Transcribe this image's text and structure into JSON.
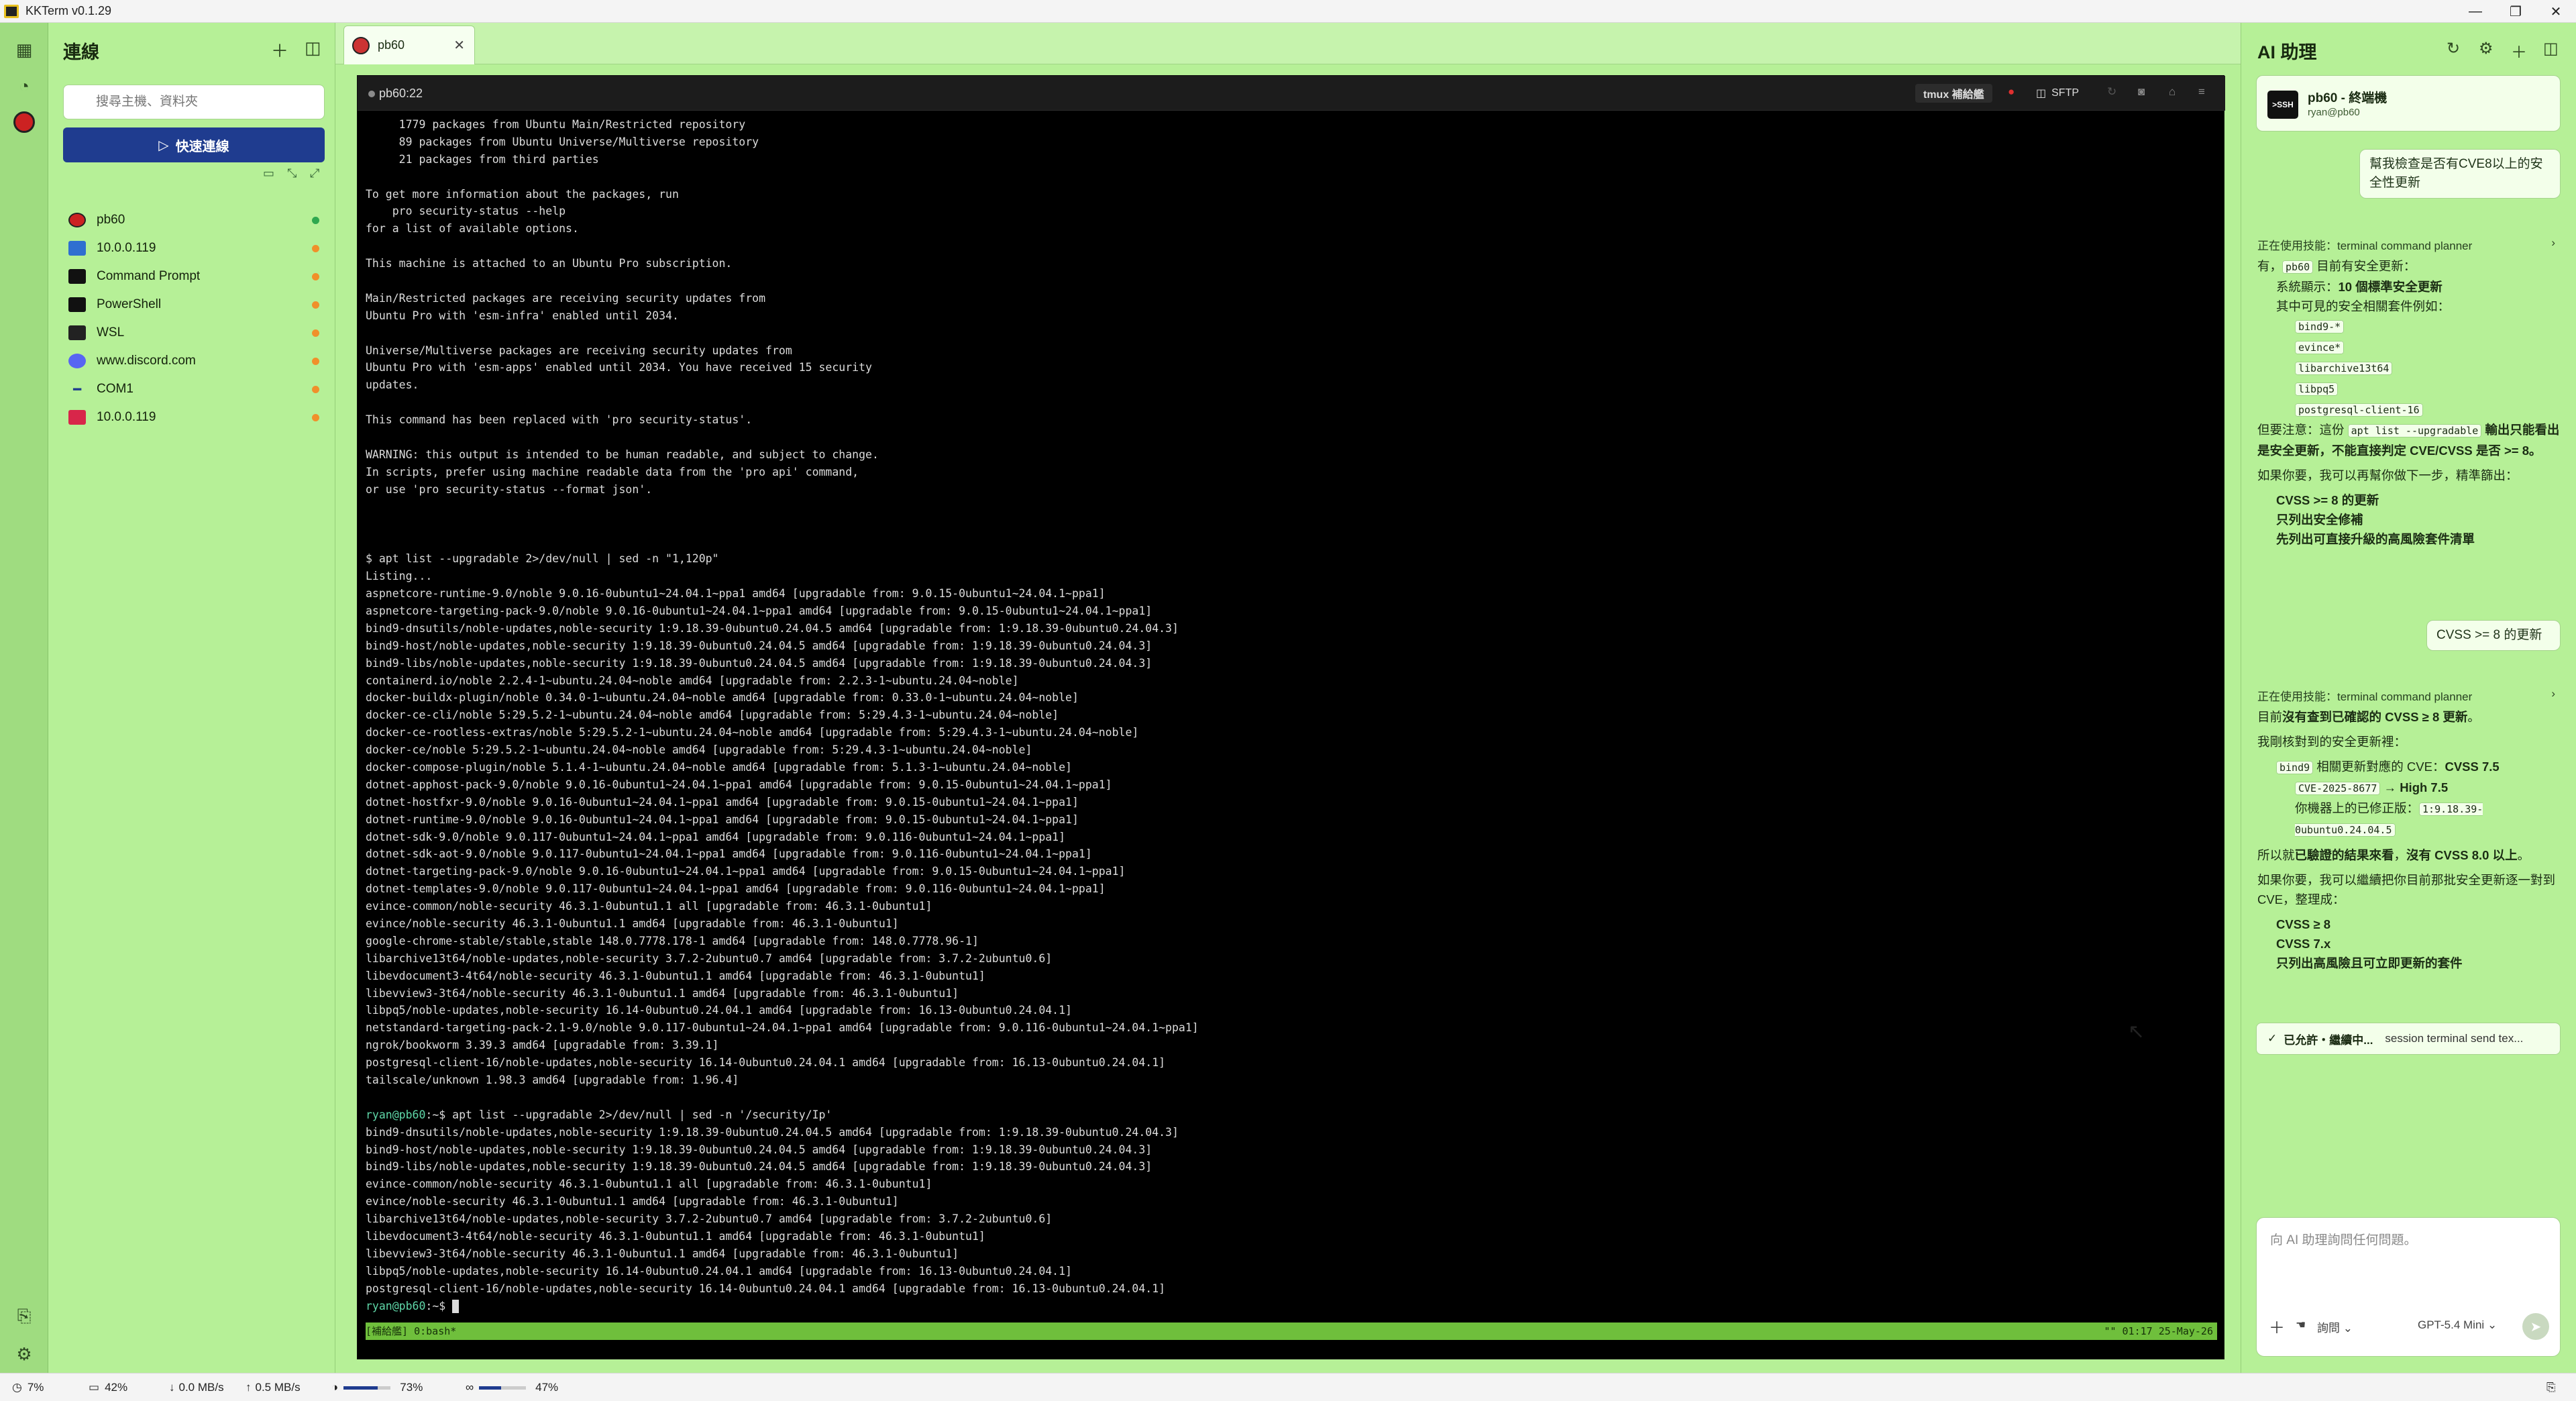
{
  "app": {
    "title": "KKTerm v0.1.29"
  },
  "sidebar": {
    "title": "連線",
    "search_placeholder": "搜尋主機、資料夾",
    "quick_connect": "快速連線",
    "connections": [
      {
        "label": "pb60",
        "icon": "ssh-icon",
        "status_color": "#2fa84f"
      },
      {
        "label": "10.0.0.119",
        "icon": "rdp-icon",
        "status_color": "#f0902a"
      },
      {
        "label": "Command Prompt",
        "icon": "cmd-icon",
        "status_color": "#f0902a"
      },
      {
        "label": "PowerShell",
        "icon": "powershell-icon",
        "status_color": "#f0902a"
      },
      {
        "label": "WSL",
        "icon": "wsl-icon",
        "status_color": "#f0902a"
      },
      {
        "label": "www.discord.com",
        "icon": "web-icon",
        "status_color": "#f0902a"
      },
      {
        "label": "COM1",
        "icon": "serial-icon",
        "status_color": "#f0902a"
      },
      {
        "label": "10.0.0.119",
        "icon": "vnc-icon",
        "status_color": "#f0902a"
      }
    ]
  },
  "tabs": [
    {
      "label": "pb60"
    }
  ],
  "terminal": {
    "session_name": "pb60:22",
    "tmux_button": "tmux 補給艦",
    "sftp_button": "SFTP",
    "lines": [
      "     1779 packages from Ubuntu Main/Restricted repository",
      "     89 packages from Ubuntu Universe/Multiverse repository",
      "     21 packages from third parties",
      "",
      "To get more information about the packages, run",
      "    pro security-status --help",
      "for a list of available options.",
      "",
      "This machine is attached to an Ubuntu Pro subscription.",
      "",
      "Main/Restricted packages are receiving security updates from",
      "Ubuntu Pro with 'esm-infra' enabled until 2034.",
      "",
      "Universe/Multiverse packages are receiving security updates from",
      "Ubuntu Pro with 'esm-apps' enabled until 2034. You have received 15 security",
      "updates.",
      "",
      "This command has been replaced with 'pro security-status'.",
      "",
      "WARNING: this output is intended to be human readable, and subject to change.",
      "In scripts, prefer using machine readable data from the 'pro api' command,",
      "or use 'pro security-status --format json'.",
      "",
      "",
      "",
      "$ apt list --upgradable 2>/dev/null | sed -n \"1,120p\"",
      "Listing...",
      "aspnetcore-runtime-9.0/noble 9.0.16-0ubuntu1~24.04.1~ppa1 amd64 [upgradable from: 9.0.15-0ubuntu1~24.04.1~ppa1]",
      "aspnetcore-targeting-pack-9.0/noble 9.0.16-0ubuntu1~24.04.1~ppa1 amd64 [upgradable from: 9.0.15-0ubuntu1~24.04.1~ppa1]",
      "bind9-dnsutils/noble-updates,noble-security 1:9.18.39-0ubuntu0.24.04.5 amd64 [upgradable from: 1:9.18.39-0ubuntu0.24.04.3]",
      "bind9-host/noble-updates,noble-security 1:9.18.39-0ubuntu0.24.04.5 amd64 [upgradable from: 1:9.18.39-0ubuntu0.24.04.3]",
      "bind9-libs/noble-updates,noble-security 1:9.18.39-0ubuntu0.24.04.5 amd64 [upgradable from: 1:9.18.39-0ubuntu0.24.04.3]",
      "containerd.io/noble 2.2.4-1~ubuntu.24.04~noble amd64 [upgradable from: 2.2.3-1~ubuntu.24.04~noble]",
      "docker-buildx-plugin/noble 0.34.0-1~ubuntu.24.04~noble amd64 [upgradable from: 0.33.0-1~ubuntu.24.04~noble]",
      "docker-ce-cli/noble 5:29.5.2-1~ubuntu.24.04~noble amd64 [upgradable from: 5:29.4.3-1~ubuntu.24.04~noble]",
      "docker-ce-rootless-extras/noble 5:29.5.2-1~ubuntu.24.04~noble amd64 [upgradable from: 5:29.4.3-1~ubuntu.24.04~noble]",
      "docker-ce/noble 5:29.5.2-1~ubuntu.24.04~noble amd64 [upgradable from: 5:29.4.3-1~ubuntu.24.04~noble]",
      "docker-compose-plugin/noble 5.1.4-1~ubuntu.24.04~noble amd64 [upgradable from: 5.1.3-1~ubuntu.24.04~noble]",
      "dotnet-apphost-pack-9.0/noble 9.0.16-0ubuntu1~24.04.1~ppa1 amd64 [upgradable from: 9.0.15-0ubuntu1~24.04.1~ppa1]",
      "dotnet-hostfxr-9.0/noble 9.0.16-0ubuntu1~24.04.1~ppa1 amd64 [upgradable from: 9.0.15-0ubuntu1~24.04.1~ppa1]",
      "dotnet-runtime-9.0/noble 9.0.16-0ubuntu1~24.04.1~ppa1 amd64 [upgradable from: 9.0.15-0ubuntu1~24.04.1~ppa1]",
      "dotnet-sdk-9.0/noble 9.0.117-0ubuntu1~24.04.1~ppa1 amd64 [upgradable from: 9.0.116-0ubuntu1~24.04.1~ppa1]",
      "dotnet-sdk-aot-9.0/noble 9.0.117-0ubuntu1~24.04.1~ppa1 amd64 [upgradable from: 9.0.116-0ubuntu1~24.04.1~ppa1]",
      "dotnet-targeting-pack-9.0/noble 9.0.16-0ubuntu1~24.04.1~ppa1 amd64 [upgradable from: 9.0.15-0ubuntu1~24.04.1~ppa1]",
      "dotnet-templates-9.0/noble 9.0.117-0ubuntu1~24.04.1~ppa1 amd64 [upgradable from: 9.0.116-0ubuntu1~24.04.1~ppa1]",
      "evince-common/noble-security 46.3.1-0ubuntu1.1 all [upgradable from: 46.3.1-0ubuntu1]",
      "evince/noble-security 46.3.1-0ubuntu1.1 amd64 [upgradable from: 46.3.1-0ubuntu1]",
      "google-chrome-stable/stable,stable 148.0.7778.178-1 amd64 [upgradable from: 148.0.7778.96-1]",
      "libarchive13t64/noble-updates,noble-security 3.7.2-2ubuntu0.7 amd64 [upgradable from: 3.7.2-2ubuntu0.6]",
      "libevdocument3-4t64/noble-security 46.3.1-0ubuntu1.1 amd64 [upgradable from: 46.3.1-0ubuntu1]",
      "libevview3-3t64/noble-security 46.3.1-0ubuntu1.1 amd64 [upgradable from: 46.3.1-0ubuntu1]",
      "libpq5/noble-updates,noble-security 16.14-0ubuntu0.24.04.1 amd64 [upgradable from: 16.13-0ubuntu0.24.04.1]",
      "netstandard-targeting-pack-2.1-9.0/noble 9.0.117-0ubuntu1~24.04.1~ppa1 amd64 [upgradable from: 9.0.116-0ubuntu1~24.04.1~ppa1]",
      "ngrok/bookworm 3.39.3 amd64 [upgradable from: 3.39.1]",
      "postgresql-client-16/noble-updates,noble-security 16.14-0ubuntu0.24.04.1 amd64 [upgradable from: 16.13-0ubuntu0.24.04.1]",
      "tailscale/unknown 1.98.3 amd64 [upgradable from: 1.96.4]",
      "",
      "ryan@pb60:~$ apt list --upgradable 2>/dev/null | sed -n '/security/Ip'",
      "bind9-dnsutils/noble-updates,noble-security 1:9.18.39-0ubuntu0.24.04.5 amd64 [upgradable from: 1:9.18.39-0ubuntu0.24.04.3]",
      "bind9-host/noble-updates,noble-security 1:9.18.39-0ubuntu0.24.04.5 amd64 [upgradable from: 1:9.18.39-0ubuntu0.24.04.3]",
      "bind9-libs/noble-updates,noble-security 1:9.18.39-0ubuntu0.24.04.5 amd64 [upgradable from: 1:9.18.39-0ubuntu0.24.04.3]",
      "evince-common/noble-security 46.3.1-0ubuntu1.1 all [upgradable from: 46.3.1-0ubuntu1]",
      "evince/noble-security 46.3.1-0ubuntu1.1 amd64 [upgradable from: 46.3.1-0ubuntu1]",
      "libarchive13t64/noble-updates,noble-security 3.7.2-2ubuntu0.7 amd64 [upgradable from: 3.7.2-2ubuntu0.6]",
      "libevdocument3-4t64/noble-security 46.3.1-0ubuntu1.1 amd64 [upgradable from: 46.3.1-0ubuntu1]",
      "libevview3-3t64/noble-security 46.3.1-0ubuntu1.1 amd64 [upgradable from: 46.3.1-0ubuntu1]",
      "libpq5/noble-updates,noble-security 16.14-0ubuntu0.24.04.1 amd64 [upgradable from: 16.13-0ubuntu0.24.04.1]",
      "postgresql-client-16/noble-updates,noble-security 16.14-0ubuntu0.24.04.1 amd64 [upgradable from: 16.13-0ubuntu0.24.04.1]"
    ],
    "prompt_user": "ryan@pb60",
    "final_prompt": "ryan@pb60:~$ ",
    "tmux_left": "[補給艦] 0:bash*",
    "tmux_right": "\"\" 01:17 25-May-26"
  },
  "ai": {
    "title": "AI 助理",
    "context_title": "pb60 - 終端機",
    "context_sub": "ryan@pb60",
    "user_msg_1": "幫我檢查是否有CVE8以上的安全性更新",
    "skill_label": "正在使用技能：terminal command planner",
    "r1_intro_a": "有，",
    "r1_intro_host": "pb60",
    "r1_intro_b": " 目前有安全更新：",
    "r1_sys_a": "系統顯示：",
    "r1_sys_b": "10 個標準安全更新",
    "r1_related": "其中可見的安全相關套件例如：",
    "r1_packages": [
      "bind9-*",
      "evince*",
      "libarchive13t64",
      "libpq5",
      "postgresql-client-16"
    ],
    "r1_note_a": "但要注意：這份 ",
    "r1_note_code": "apt list --upgradable",
    "r1_note_b": " 輸出只能看出是安全更新，不能直接判定 CVE/CVSS 是否 >= 8。",
    "r1_next": "如果你要，我可以再幫你做下一步，精準篩出：",
    "r1_options": [
      "CVSS >= 8 的更新",
      "只列出安全修補",
      "先列出可直接升級的高風險套件清單"
    ],
    "user_msg_2": "CVSS >= 8 的更新",
    "r2_intro_a": "目前",
    "r2_intro_b": "沒有查到已確認的 CVSS ≥ 8 更新",
    "r2_intro_c": "。",
    "r2_found": "我剛核對到的安全更新裡：",
    "r2_pkg": "bind9",
    "r2_pkg_desc_a": " 相關更新對應的 CVE：",
    "r2_pkg_desc_b": "CVSS 7.5",
    "r2_cve": "CVE-2025-8677",
    "r2_cve_arrow": " → ",
    "r2_cve_sev": "High 7.5",
    "r2_installed": "你機器上的已修正版：",
    "r2_installed_ver": "1:9.18.39-0ubuntu0.24.04.5",
    "r2_conclusion_a": "所以就",
    "r2_conclusion_b": "已驗證的結果來看",
    "r2_conclusion_c": "，",
    "r2_conclusion_d": "沒有 CVSS 8.0 以上",
    "r2_conclusion_e": "。",
    "r2_next": "如果你要，我可以繼續把你目前那批安全更新逐一對到 CVE，整理成：",
    "r2_options": [
      "CVSS ≥ 8",
      "CVSS 7.x",
      "只列出高風險且可立即更新的套件"
    ],
    "approval_a": "已允許・繼續中...",
    "approval_b": "session terminal send tex...",
    "composer_placeholder": "向 AI 助理詢問任何問題。",
    "mode_label": "詢問",
    "model_label": "GPT-5.4 Mini"
  },
  "status": {
    "cpu": "7%",
    "ram": "42%",
    "down": "0.0 MB/s",
    "up": "0.5 MB/s",
    "disk": "73%",
    "disk_fraction": 0.73,
    "gpu": "47%",
    "gpu_fraction": 0.47
  }
}
